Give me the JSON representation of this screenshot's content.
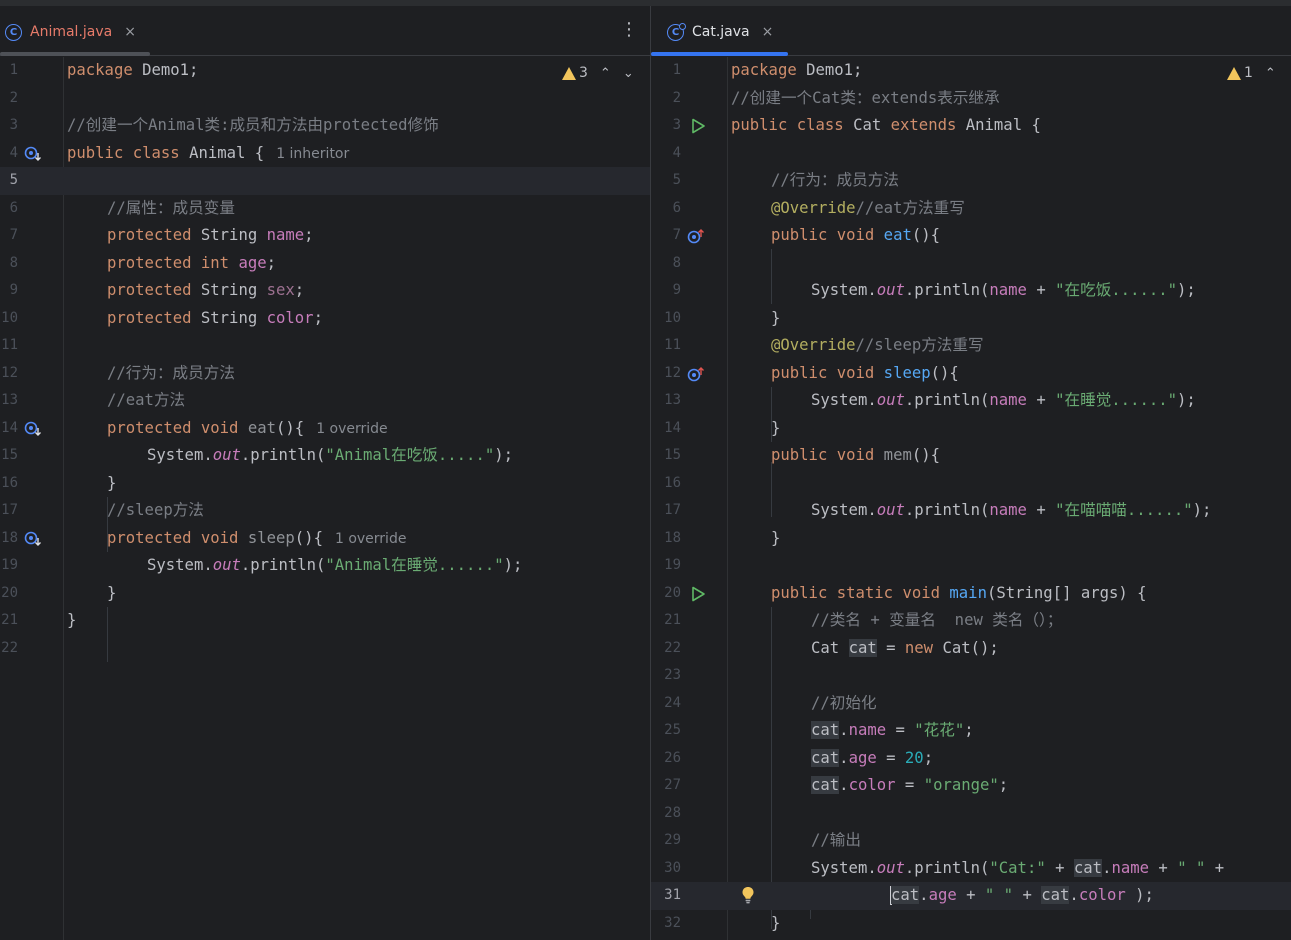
{
  "left_tab": {
    "icon": "class-icon",
    "icon_letter": "C",
    "label": "Animal.java",
    "close": "×"
  },
  "right_tab": {
    "icon": "class-icon",
    "icon_letter": "C",
    "label": "Cat.java",
    "close": "×"
  },
  "left_warnings": {
    "count": "3"
  },
  "right_warnings": {
    "count": "1"
  },
  "menu_glyph": "⋮",
  "arrow_up": "⌃",
  "arrow_down": "⌄",
  "left_code": {
    "ln": [
      "1",
      "2",
      "3",
      "4",
      "5",
      "6",
      "7",
      "8",
      "9",
      "10",
      "11",
      "12",
      "13",
      "14",
      "15",
      "16",
      "17",
      "18",
      "19",
      "20",
      "21",
      "22"
    ],
    "l1": [
      "package",
      " Demo1;"
    ],
    "l3": "//创建一个Animal类:成员和方法由protected修饰",
    "l4": [
      "public",
      " class",
      " Animal {",
      "1 inheritor"
    ],
    "l6": "//属性：成员变量",
    "l7": [
      "protected",
      " String ",
      "name",
      ";"
    ],
    "l8": [
      "protected",
      " int",
      " ",
      "age",
      ";"
    ],
    "l9": [
      "protected",
      " String ",
      "sex",
      ";"
    ],
    "l10": [
      "protected",
      " String ",
      "color",
      ";"
    ],
    "l12": "//行为：成员方法",
    "l13": "//eat方法",
    "l14": [
      "protected",
      " void",
      " eat",
      "(){",
      "1 override"
    ],
    "l15": [
      "System.",
      "out",
      ".println(",
      "\"Animal在吃饭.....\"",
      ");"
    ],
    "l16": "}",
    "l17": "//sleep方法",
    "l18": [
      "protected",
      " void",
      " sleep",
      "(){",
      "1 override"
    ],
    "l19": [
      "System.",
      "out",
      ".println(",
      "\"Animal在睡觉......\"",
      ");"
    ],
    "l20": "}",
    "l21": "}"
  },
  "right_code": {
    "ln": [
      "1",
      "2",
      "3",
      "4",
      "5",
      "6",
      "7",
      "8",
      "9",
      "10",
      "11",
      "12",
      "13",
      "14",
      "15",
      "16",
      "17",
      "18",
      "19",
      "20",
      "21",
      "22",
      "23",
      "24",
      "25",
      "26",
      "27",
      "28",
      "29",
      "30",
      "31",
      "32"
    ],
    "l1": [
      "package",
      " Demo1;"
    ],
    "l2": "//创建一个Cat类：extends表示继承",
    "l3": [
      "public",
      " class",
      " Cat ",
      "extends",
      " Animal {"
    ],
    "l5": "//行为：成员方法",
    "l6": [
      "@Override",
      "//eat方法重写"
    ],
    "l7": [
      "public",
      " void",
      " eat",
      "(){"
    ],
    "l9": [
      "System.",
      "out",
      ".println(",
      "name",
      " + ",
      "\"在吃饭......\"",
      ");"
    ],
    "l10": "}",
    "l11": [
      "@Override",
      "//sleep方法重写"
    ],
    "l12": [
      "public",
      " void",
      " sleep",
      "(){"
    ],
    "l13": [
      "System.",
      "out",
      ".println(",
      "name",
      " + ",
      "\"在睡觉......\"",
      ");"
    ],
    "l14": "}",
    "l15": [
      "public",
      " void",
      " mem",
      "(){"
    ],
    "l17": [
      "System.",
      "out",
      ".println(",
      "name",
      " + ",
      "\"在喵喵喵......\"",
      ");"
    ],
    "l18": "}",
    "l20": [
      "public",
      " static",
      " void",
      " main",
      "(String[] args) {"
    ],
    "l21": "//类名 + 变量名  new 类名（）；",
    "l22": [
      "Cat ",
      "cat",
      " = ",
      "new",
      " Cat();"
    ],
    "l24": "//初始化",
    "l25": [
      "cat",
      ".",
      "name",
      " = ",
      "\"花花\"",
      ";"
    ],
    "l26": [
      "cat",
      ".",
      "age",
      " = ",
      "20",
      ";"
    ],
    "l27": [
      "cat",
      ".",
      "color",
      " = ",
      "\"orange\"",
      ";"
    ],
    "l29": "//输出",
    "l30": [
      "System.",
      "out",
      ".println(",
      "\"Cat:\"",
      " + ",
      "cat",
      ".",
      "name",
      " + ",
      "\" \"",
      " +"
    ],
    "l31": [
      "cat",
      ".",
      "age",
      " + ",
      "\" \"",
      " + ",
      "cat",
      ".",
      "color",
      " );"
    ],
    "l32": "}"
  }
}
